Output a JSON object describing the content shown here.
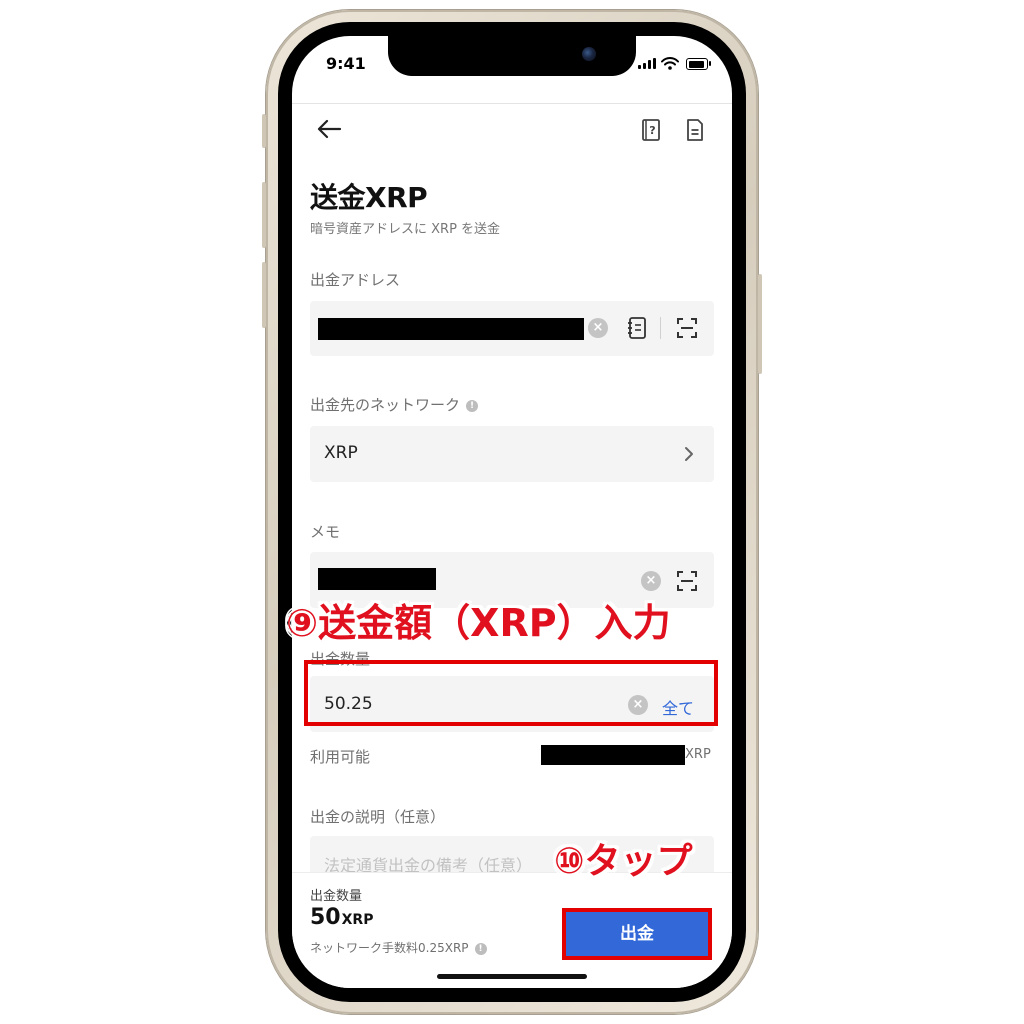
{
  "status": {
    "time": "9:41"
  },
  "header": {
    "back_icon": "arrow-left-icon",
    "help_icon": "help-book-icon",
    "history_icon": "document-icon"
  },
  "page": {
    "title": "送金XRP",
    "subtitle": "暗号資産アドレスに XRP を送金"
  },
  "address": {
    "label": "出金アドレス",
    "value_redacted": true,
    "icons": [
      "clear-icon",
      "address-book-icon",
      "scan-icon"
    ]
  },
  "network": {
    "label": "出金先のネットワーク",
    "value": "XRP",
    "icon": "chevron-right-icon"
  },
  "memo": {
    "label": "メモ",
    "value_redacted": true
  },
  "amount": {
    "label": "出金数量",
    "value": "50.25",
    "all_label": "全て",
    "available_label": "利用可能",
    "available_unit": "XRP"
  },
  "description": {
    "label": "出金の説明（任意）",
    "placeholder": "法定通貨出金の備考（任意）"
  },
  "summary": {
    "label": "出金数量",
    "amount": "50",
    "unit": "XRP",
    "fee_text": "ネットワーク手数料0.25XRP"
  },
  "submit": {
    "label": "出金"
  },
  "annotations": {
    "step9": "⑨送金額（XRP）入力",
    "step10": "⑩タップ",
    "color": "#e0101e"
  },
  "colors": {
    "accent": "#3268d8",
    "highlight": "#e30000"
  }
}
